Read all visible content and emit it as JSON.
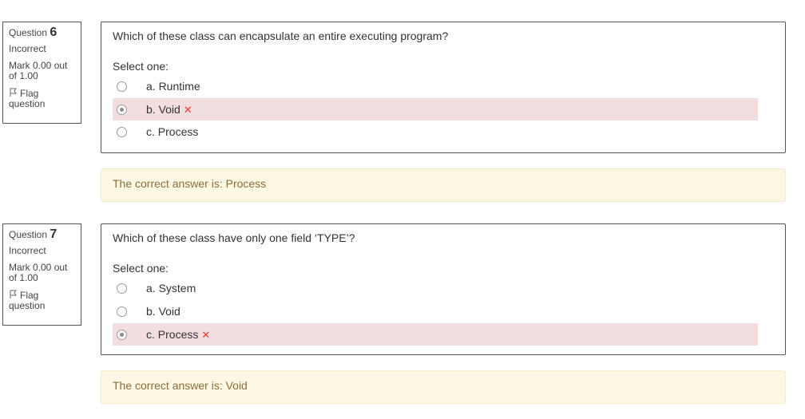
{
  "questions": [
    {
      "label": "Question",
      "number": "6",
      "state": "Incorrect",
      "mark": "Mark 0.00 out of 1.00",
      "flag": "Flag question",
      "text": "Which of these class can encapsulate an entire executing program?",
      "prompt": "Select one:",
      "answers": [
        {
          "label": "a. Runtime",
          "selected": false,
          "incorrect": false
        },
        {
          "label": "b. Void",
          "selected": true,
          "incorrect": true
        },
        {
          "label": "c. Process",
          "selected": false,
          "incorrect": false
        }
      ],
      "feedback": "The correct answer is: Process"
    },
    {
      "label": "Question",
      "number": "7",
      "state": "Incorrect",
      "mark": "Mark 0.00 out of 1.00",
      "flag": "Flag question",
      "text": "Which of these class have only one field ‘TYPE’?",
      "prompt": "Select one:",
      "answers": [
        {
          "label": "a. System",
          "selected": false,
          "incorrect": false
        },
        {
          "label": "b. Void",
          "selected": false,
          "incorrect": false
        },
        {
          "label": "c. Process",
          "selected": true,
          "incorrect": true
        }
      ],
      "feedback": "The correct answer is: Void"
    }
  ],
  "colors": {
    "incorrect_bg": "#f2dede",
    "feedback_bg": "#fcf8e3",
    "feedback_text": "#8a6d3b",
    "xmark": "#e53935"
  },
  "icons": {
    "flag": "flag-outline-icon",
    "incorrect": "x-mark-icon"
  }
}
